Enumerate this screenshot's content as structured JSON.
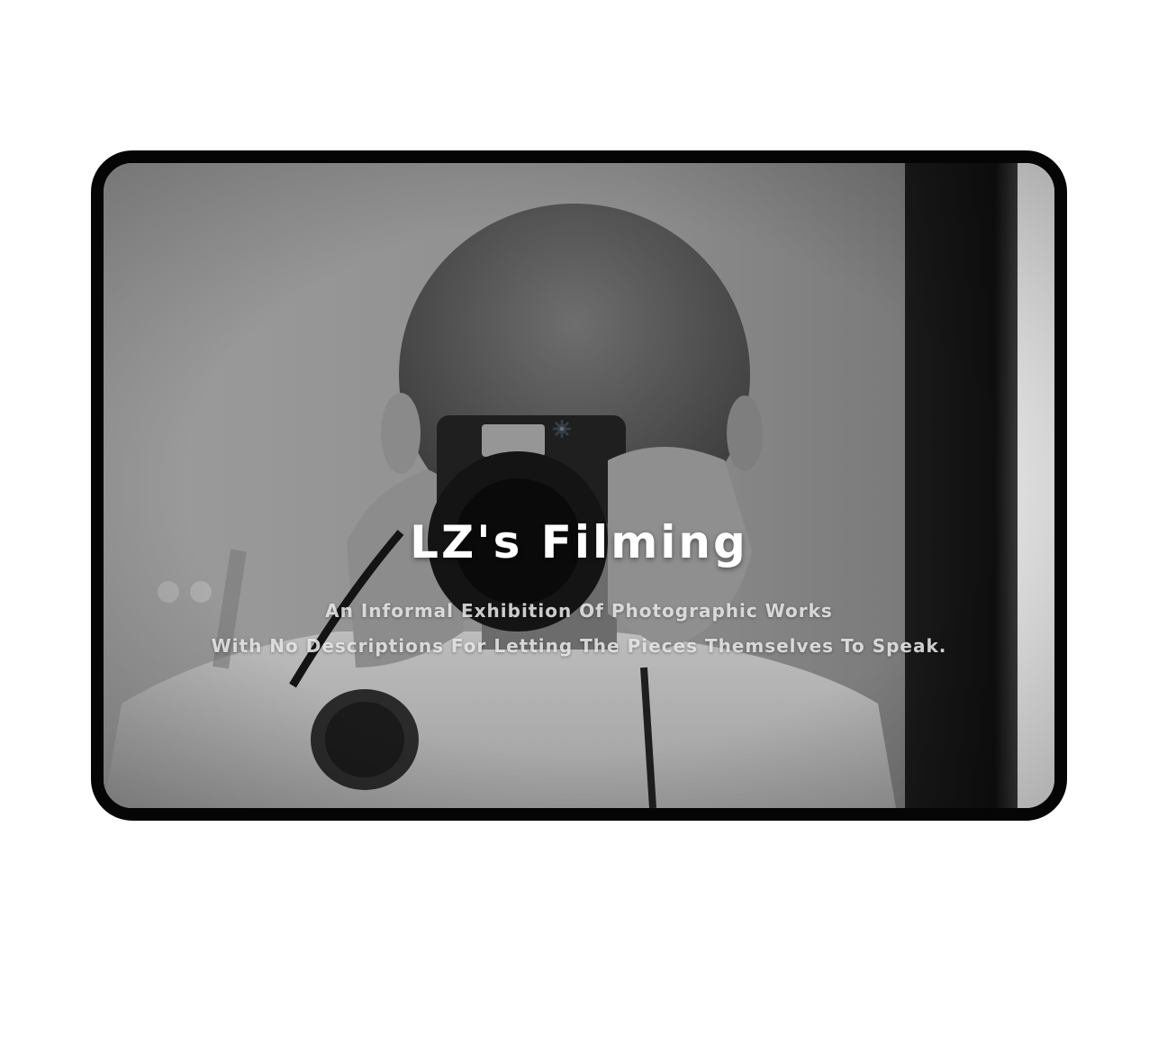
{
  "hero": {
    "title": "LZ's Filming",
    "subtitle_line1": "An Informal Exhibition Of Photographic Works",
    "subtitle_line2": "With No Descriptions For Letting The Pieces Themselves To Speak."
  },
  "icons": {
    "settings": "gear-icon"
  },
  "colors": {
    "page_background": "#ffffff",
    "frame_border": "#050505",
    "title_text": "#ffffff"
  }
}
